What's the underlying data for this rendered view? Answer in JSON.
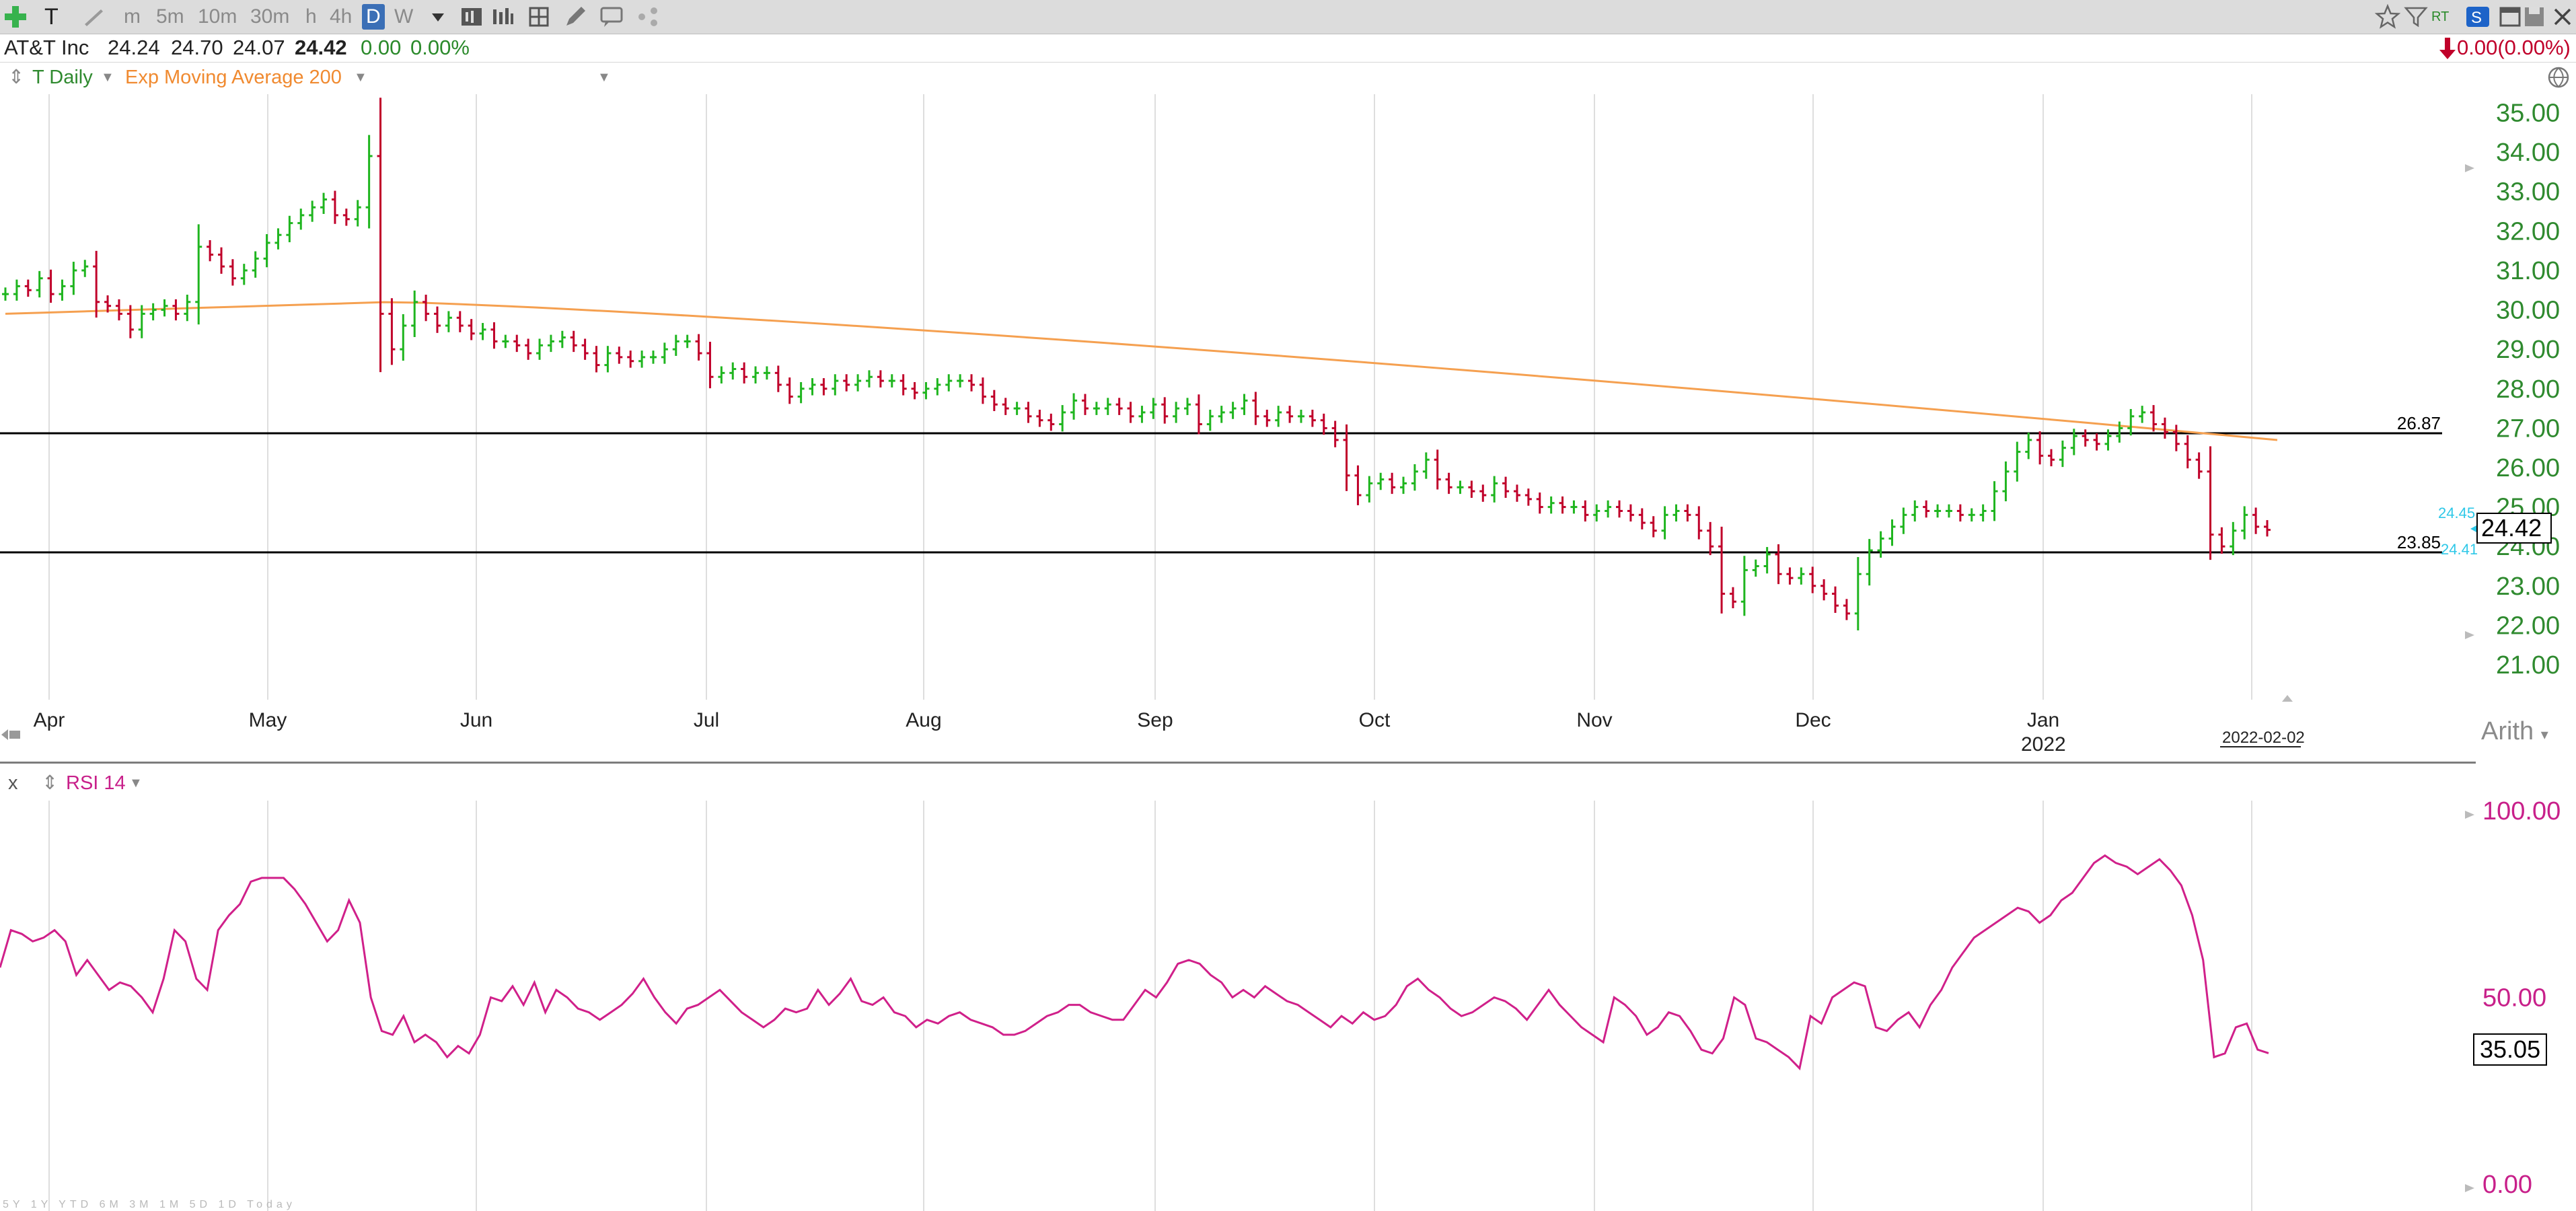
{
  "toolbar": {
    "symbol": "T",
    "intervals": [
      "m",
      "5m",
      "10m",
      "30m",
      "h",
      "4h",
      "D",
      "W"
    ],
    "active_interval": "D",
    "right_label": "RT"
  },
  "quote": {
    "name": "AT&T Inc",
    "open": "24.24",
    "high": "24.70",
    "low": "24.07",
    "last": "24.42",
    "change": "0.00",
    "change_pct": "0.00%",
    "right_change": "0.00(0.00%)"
  },
  "studies": {
    "main_label": "T Daily",
    "ema_label": "Exp Moving Average 200",
    "rsi_close": "x",
    "rsi_label": "RSI 14"
  },
  "price_axis": {
    "labels": [
      "35.00",
      "34.00",
      "33.00",
      "32.00",
      "31.00",
      "30.00",
      "29.00",
      "28.00",
      "27.00",
      "26.00",
      "25.00",
      "24.00",
      "23.00",
      "22.00",
      "21.00"
    ],
    "current_price": "24.42",
    "bid": "24.45",
    "ask": "24.41",
    "upper_line_label": "26.87",
    "lower_line_label": "23.85",
    "scale_mode": "Arith"
  },
  "date_axis": {
    "months": [
      "Apr",
      "May",
      "Jun",
      "Jul",
      "Aug",
      "Sep",
      "Oct",
      "Nov",
      "Dec",
      "Jan"
    ],
    "year": "2022",
    "cursor_date": "2022-02-02"
  },
  "rsi_axis": {
    "labels": [
      "100.00",
      "50.00",
      "0.00"
    ],
    "current": "35.05"
  },
  "bottom_ranges": "5Y 1Y YTD 6M 3M 1M 5D 1D Today",
  "colors": {
    "up": "#1fb51f",
    "down": "#c0002a",
    "ema": "#f5a050",
    "rsi": "#d0208a",
    "axis_green": "#2f8a2f",
    "axis_magenta": "#c8208a"
  },
  "chart_data": [
    {
      "type": "ohlc",
      "title": "T Daily",
      "ylim": [
        21,
        35
      ],
      "x_months": [
        "Apr",
        "May",
        "Jun",
        "Jul",
        "Aug",
        "Sep",
        "Oct",
        "Nov",
        "Dec",
        "Jan"
      ],
      "close": [
        30.4,
        30.6,
        30.5,
        30.8,
        30.4,
        30.6,
        31.0,
        31.1,
        30.2,
        30.1,
        29.9,
        29.5,
        29.9,
        30.0,
        30.1,
        29.9,
        30.2,
        31.6,
        31.4,
        31.1,
        30.8,
        31.0,
        31.3,
        31.7,
        31.9,
        32.2,
        32.4,
        32.6,
        32.8,
        32.4,
        32.3,
        32.6,
        33.9,
        29.9,
        29.0,
        29.6,
        30.2,
        29.9,
        29.6,
        29.8,
        29.6,
        29.4,
        29.5,
        29.2,
        29.2,
        29.1,
        28.9,
        29.1,
        29.2,
        29.3,
        29.1,
        28.9,
        28.6,
        28.9,
        28.8,
        28.7,
        28.8,
        28.8,
        29.0,
        29.2,
        29.2,
        28.9,
        28.3,
        28.4,
        28.5,
        28.3,
        28.4,
        28.4,
        28.1,
        27.8,
        28.0,
        28.1,
        28.0,
        28.2,
        28.1,
        28.2,
        28.3,
        28.2,
        28.2,
        28.0,
        27.9,
        28.0,
        28.1,
        28.2,
        28.2,
        28.1,
        27.8,
        27.6,
        27.5,
        27.5,
        27.3,
        27.2,
        27.1,
        27.4,
        27.7,
        27.5,
        27.5,
        27.6,
        27.5,
        27.3,
        27.4,
        27.6,
        27.3,
        27.5,
        27.6,
        27.1,
        27.3,
        27.4,
        27.5,
        27.7,
        27.3,
        27.2,
        27.4,
        27.3,
        27.3,
        27.2,
        27.0,
        26.7,
        25.8,
        25.3,
        25.6,
        25.7,
        25.5,
        25.6,
        25.9,
        26.2,
        25.7,
        25.5,
        25.5,
        25.4,
        25.3,
        25.6,
        25.4,
        25.3,
        25.2,
        25.0,
        25.1,
        25.0,
        25.0,
        24.8,
        24.9,
        25.0,
        24.9,
        24.8,
        24.6,
        24.4,
        24.8,
        24.9,
        24.8,
        24.4,
        24.0,
        22.8,
        22.6,
        23.4,
        23.5,
        23.8,
        23.3,
        23.2,
        23.3,
        23.0,
        22.8,
        22.5,
        22.3,
        23.3,
        23.9,
        24.2,
        24.5,
        24.8,
        25.0,
        24.9,
        24.9,
        24.9,
        24.8,
        24.8,
        24.9,
        25.4,
        25.9,
        26.4,
        26.7,
        26.3,
        26.2,
        26.5,
        26.8,
        26.7,
        26.6,
        26.8,
        27.0,
        27.3,
        27.4,
        27.1,
        26.9,
        26.6,
        26.2,
        25.9,
        24.3,
        24.0,
        24.4,
        24.8,
        24.5,
        24.42
      ],
      "ema_200": {
        "start": 29.9,
        "peak": 30.2,
        "end": 26.7
      }
    },
    {
      "type": "line",
      "title": "RSI 14",
      "ylim": [
        0,
        100
      ],
      "values": [
        58,
        68,
        67,
        65,
        66,
        68,
        65,
        56,
        60,
        56,
        52,
        54,
        53,
        50,
        46,
        55,
        68,
        65,
        55,
        52,
        68,
        72,
        75,
        81,
        82,
        82,
        82,
        79,
        75,
        70,
        65,
        68,
        76,
        70,
        50,
        41,
        40,
        45,
        38,
        40,
        38,
        34,
        37,
        35,
        40,
        50,
        49,
        53,
        48,
        54,
        46,
        52,
        50,
        47,
        46,
        44,
        46,
        48,
        51,
        55,
        50,
        46,
        43,
        47,
        48,
        50,
        52,
        49,
        46,
        44,
        42,
        44,
        47,
        46,
        47,
        52,
        48,
        51,
        55,
        49,
        48,
        50,
        46,
        45,
        42,
        44,
        43,
        45,
        46,
        44,
        43,
        42,
        40,
        40,
        41,
        43,
        45,
        46,
        48,
        48,
        46,
        45,
        44,
        44,
        48,
        52,
        50,
        54,
        59,
        60,
        59,
        56,
        54,
        50,
        52,
        50,
        53,
        51,
        49,
        48,
        46,
        44,
        42,
        45,
        43,
        46,
        44,
        45,
        48,
        53,
        55,
        52,
        50,
        47,
        45,
        46,
        48,
        50,
        49,
        47,
        44,
        48,
        52,
        48,
        45,
        42,
        40,
        38,
        50,
        48,
        45,
        40,
        42,
        46,
        45,
        41,
        36,
        35,
        39,
        50,
        48,
        39,
        38,
        36,
        34,
        31,
        45,
        43,
        50,
        52,
        54,
        53,
        42,
        41,
        44,
        46,
        42,
        48,
        52,
        58,
        62,
        66,
        68,
        70,
        72,
        74,
        73,
        70,
        72,
        76,
        78,
        82,
        86,
        88,
        86,
        85,
        83,
        85,
        87,
        84,
        80,
        72,
        60,
        34,
        35,
        42,
        43,
        36,
        35.05
      ]
    }
  ]
}
